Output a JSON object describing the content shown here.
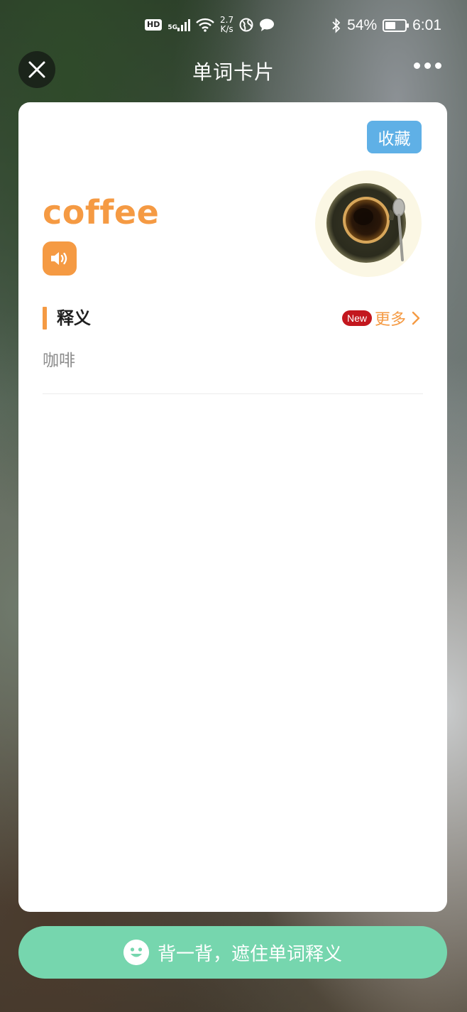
{
  "status_bar": {
    "hd": "HD",
    "network": "5G",
    "speed_value": "2.7",
    "speed_unit": "K/s",
    "battery_percent": "54%",
    "battery_level": 0.54,
    "time": "6:01"
  },
  "nav": {
    "title": "单词卡片"
  },
  "card": {
    "favorite_label": "收藏",
    "word": "coffee",
    "section_title": "释义",
    "new_badge": "New",
    "more_label": "更多",
    "meaning": "咖啡"
  },
  "bottom": {
    "recite_label": "背一背，遮住单词释义"
  },
  "colors": {
    "accent": "#f59a43",
    "favorite_button": "#5fb0e6",
    "new_badge": "#c3171e",
    "recite_button": "#76d6ae"
  },
  "icons": {
    "close": "close-icon",
    "more": "more-dots-icon",
    "speaker": "speaker-icon",
    "chevron": "chevron-right-icon",
    "smile": "smile-icon",
    "bluetooth": "bluetooth-icon",
    "wifi": "wifi-icon",
    "signal": "signal-icon",
    "globe": "globe-icon",
    "message": "message-icon",
    "battery": "battery-icon"
  }
}
